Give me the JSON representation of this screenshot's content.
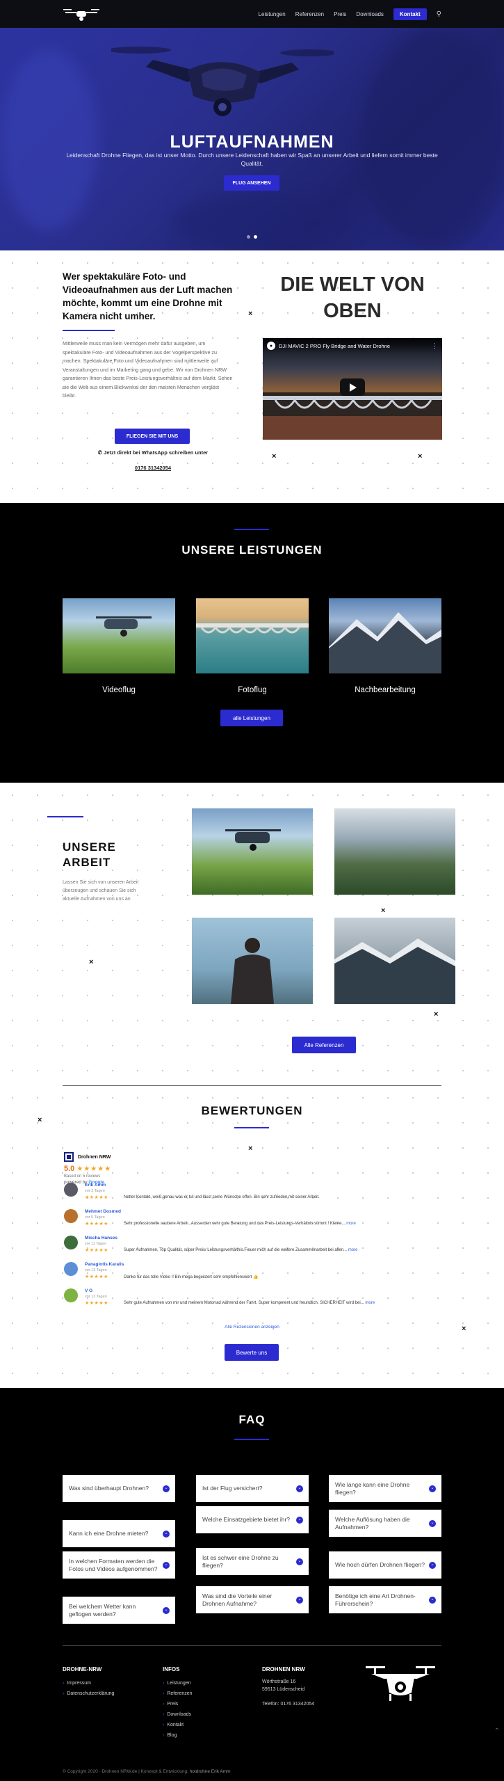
{
  "header": {
    "nav": [
      "Leistungen",
      "Referenzen",
      "Preis",
      "Downloads"
    ],
    "cta": "Kontakt"
  },
  "hero": {
    "title": "LUFTAUFNAHMEN",
    "subtitle": "Leidenschaft Drohne Fliegen, das ist unser Motto. Durch unsere Leidenschaft haben wir Spaß an unserer Arbeit und liefern somit immer beste Qualität.",
    "button": "FLUG ANSEHEN"
  },
  "intro": {
    "heading": "Wer spektakuläre Foto- und Videoaufnahmen aus der Luft machen möchte, kommt um eine Drohne mit Kamera nicht umher.",
    "paragraph": "Mittlerweile muss man kein Vermögen mehr dafür ausgeben, um spektakuläre Foto- und Videoaufnahmen aus der Vogelperspektive zu machen. Spektakuläre Foto und Videoaufnahmen sind mittlerweile auf Veranstaltungen und im Marketing gang und gebe. Wir von Drohnen NRW garantieren Ihnen das beste Preis-Leistungsverhältnis auf dem Markt. Sehen sie die Welt aus einem Blickwinkel der den meisten Menschen verglöst bleibt.",
    "button": "FLIEGEN SIE MIT UNS",
    "whatsapp": "✆ Jetzt direkt bei WhatsApp schreiben unter",
    "phone": "0176 31342054",
    "world_heading": "DIE WELT VON OBEN",
    "video_title": "DJI MAVIC 2 PRO Fly Bridge and Water Drohne"
  },
  "services": {
    "title": "UNSERE LEISTUNGEN",
    "items": [
      "Videoflug",
      "Fotoflug",
      "Nachbearbeitung"
    ],
    "button": "alle Leistungen"
  },
  "work": {
    "title_line1": "UNSERE",
    "title_line2": "ARBEIT",
    "paragraph": "Lassen Sie sich von unseren Arbeit überzeugen und schauen Sie sich aktuelle Aufnahmen von uns an",
    "button": "Alle Referenzen"
  },
  "reviews": {
    "title": "BEWERTUNGEN",
    "brand": "Drohnen NRW",
    "score": "5.0",
    "stars": "★★★★★",
    "based_on": "Based on 5 reviews",
    "powered_prefix": "powered by",
    "powered_brand": "Google",
    "items": [
      {
        "name": "Erik Amm",
        "ago": "vor 3 Tagen",
        "stars": "★★★★★",
        "text": "Netter Kontakt, weiß genau was er tut und lässt seine Wünsche offen. Bin sehr zufrieden mit seiner Arbeit.",
        "more": "",
        "color": "#5a5a66"
      },
      {
        "name": "Mehmet Dosmed",
        "ago": "vor 5 Tagen",
        "stars": "★★★★★",
        "text": "Sehr professionelle saubere Arbeit...Ausserden sehr gute Beratung und das Preis-Leistungs-Verhältnis stimmt ! Kleine...",
        "more": "more",
        "color": "#b8702d"
      },
      {
        "name": "Mischa Hanses",
        "ago": "vor 11 Tagen",
        "stars": "★★★★★",
        "text": "Super Aufnahmen, Top Qualität, super Preis/ Leistungsverhältnis.Fieuer mich auf die weitere Zusammenarbeit bei allen...",
        "more": "more",
        "color": "#3d6e3a"
      },
      {
        "name": "Panagiotis Karalis",
        "ago": "vor 13 Tagen",
        "stars": "★★★★★",
        "text": "Danke für das tolle Video !! Bin mega begeistert sehr empfehlenswert 👍",
        "more": "",
        "color": "#5d8fd6"
      },
      {
        "name": "V G",
        "ago": "vor 13 Tagen",
        "stars": "★★★★★",
        "text": "Sehr gute Aufnahmen von mir und meinem Motorrad während der Fahrt. Super kompetent und freundlich. SICHERHEIT wird bei...",
        "more": "more",
        "color": "#7cb342"
      }
    ],
    "all_link": "Alle Rezensionen anzeigen",
    "button": "Bewerte uns"
  },
  "faq": {
    "title": "FAQ",
    "col1": [
      "Was sind überhaupt Drohnen?",
      "Kann ich eine Drohne mieten?",
      "In welchen Formaten werden die Fotos und Videos aufgenommen?",
      "Bei welchem Wetter kann geflogen werden?"
    ],
    "col2": [
      "Ist der Flug versichert?",
      "Welche Einsatzgebiete bietet ihr?",
      "Ist es schwer eine Drohne zu fliegen?",
      "Was sind die Vorteile einer Drohnen Aufnahme?"
    ],
    "col3": [
      "Wie lange kann eine Drohne fliegen?",
      "Welche Auflösung haben die Aufnahmen?",
      "Wie hoch dürfen Drohnen fliegen?",
      "Benötige ich eine Art Drohnen-Führerschein?"
    ]
  },
  "footer": {
    "col1_title": "DROHNE-NRW",
    "col1_links": [
      "Impressum",
      "Datenschutzerklärung"
    ],
    "col2_title": "INFOS",
    "col2_links": [
      "Leistungen",
      "Referenzen",
      "Preis",
      "Downloads",
      "Kontakt",
      "Blog"
    ],
    "col3_title": "DROHNEN NRW",
    "address_line1": "Wörthstraße 16",
    "address_line2": "59513 Lüdenscheid",
    "phone": "Telefon: 0176 31342054",
    "copyright_prefix": "© Copyright 2020 · Drohnen NRW.de | Konzept & Entwicklung:",
    "copyright_brand": "hotdrohne Erik Amm"
  }
}
